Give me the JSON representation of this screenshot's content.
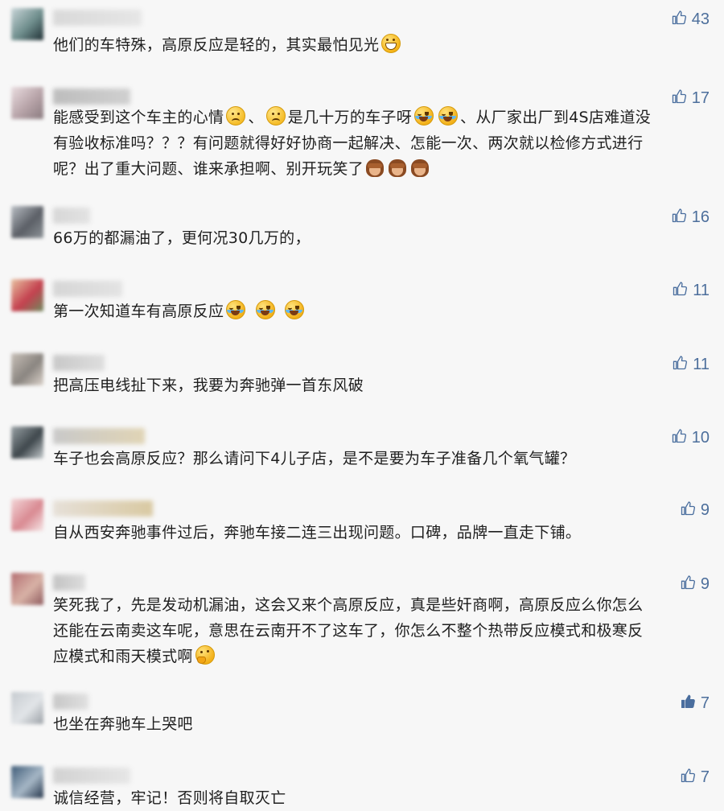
{
  "comments": [
    {
      "text": "他们的车特殊，高原反应是轻的，其实最怕见光",
      "emojis": [
        "grin"
      ],
      "likes": "43",
      "liked": false,
      "avatar_colors": [
        "#c9d6d9",
        "#6e8d8c",
        "#1f2f34"
      ],
      "nick_colors": [
        "#d9d9d9",
        "#e6e6e6"
      ]
    },
    {
      "text_lines": [
        "能感受到这个车主的心情",
        "、",
        "是几十万的车子呀",
        "、从厂家出厂到4S店难道没",
        "有验收标准吗？？？有问题就得好好协商一起解决、怎能一次、两次就以检修方式进行",
        "呢？出了重大问题、谁来承担啊、别开玩笑了"
      ],
      "likes": "17",
      "liked": false,
      "avatar_colors": [
        "#eadde0",
        "#b7a3a8",
        "#8a7b7f"
      ],
      "nick_colors": [
        "#bdbdbd",
        "#d0d0d0"
      ]
    },
    {
      "text": "66万的都漏油了，更何况30几万的，",
      "likes": "16",
      "liked": false,
      "avatar_colors": [
        "#b9bec4",
        "#5b5f66",
        "#8d9398"
      ],
      "nick_colors": [
        "#d7d7d7",
        "#e2e2e2"
      ]
    },
    {
      "text": "第一次知道车有高原反应",
      "emojis": [
        "cry",
        "cry",
        "cry"
      ],
      "likes": "11",
      "liked": false,
      "avatar_colors": [
        "#e8c1a0",
        "#c4414f",
        "#6f8a5e"
      ],
      "nick_colors": [
        "#d6d6d6",
        "#e3e3e3"
      ]
    },
    {
      "text": "把高压电线扯下来，我要为奔驰弹一首东风破",
      "likes": "11",
      "liked": false,
      "avatar_colors": [
        "#c8c0b8",
        "#8a8580",
        "#dcd3cb"
      ],
      "nick_colors": [
        "#c8c8c8",
        "#dedede"
      ]
    },
    {
      "text": "车子也会高原反应？那么请问下4儿子店，是不是要为车子准备几个氧气罐？",
      "likes": "10",
      "liked": false,
      "avatar_colors": [
        "#9aa2a6",
        "#3e474c",
        "#c5cbce"
      ],
      "nick_colors": [
        "#c9c9c9",
        "#e0d4b5"
      ]
    },
    {
      "text": "自从西安奔驰事件过后，奔驰车接二连三出现问题。口碑，品牌一直走下铺。",
      "likes": "9",
      "liked": false,
      "avatar_colors": [
        "#f3d6d8",
        "#d98a92",
        "#f6e6e7"
      ],
      "nick_colors": [
        "#e6e0d8",
        "#d9c9a2"
      ]
    },
    {
      "text_lines": [
        "笑死我了，先是发动机漏油，这会又来个高原反应，真是些奸商啊，高原反应么你怎么",
        "还能在云南卖这车呢，意思在云南开不了这车了，你怎么不整个热带反应模式和极寒反",
        "应模式和雨天模式啊"
      ],
      "likes": "9",
      "liked": false,
      "avatar_colors": [
        "#b46e72",
        "#d8b2a6",
        "#8f5b5e"
      ],
      "nick_colors": [
        "#c3c3c3",
        "#dddddd"
      ]
    },
    {
      "text": "也坐在奔驰车上哭吧",
      "likes": "7",
      "liked": true,
      "avatar_colors": [
        "#c6cbd0",
        "#e2e5e8",
        "#9aa0a6"
      ],
      "nick_colors": [
        "#c7c7c7",
        "#e0e0e0"
      ]
    },
    {
      "text": "诚信经营，牢记！否则将自取灭亡",
      "likes": "7",
      "liked": false,
      "avatar_colors": [
        "#3f5c78",
        "#a6b7c6",
        "#23344a"
      ],
      "nick_colors": [
        "#d2d2d2",
        "#e6e6e6"
      ]
    }
  ],
  "icons": {
    "like": "thumbs-up-icon"
  },
  "colors": {
    "like_text": "#4d6f9c",
    "like_filled": "#4a6e9e",
    "background": "#f7f7f7",
    "text": "#1f1f1f"
  }
}
